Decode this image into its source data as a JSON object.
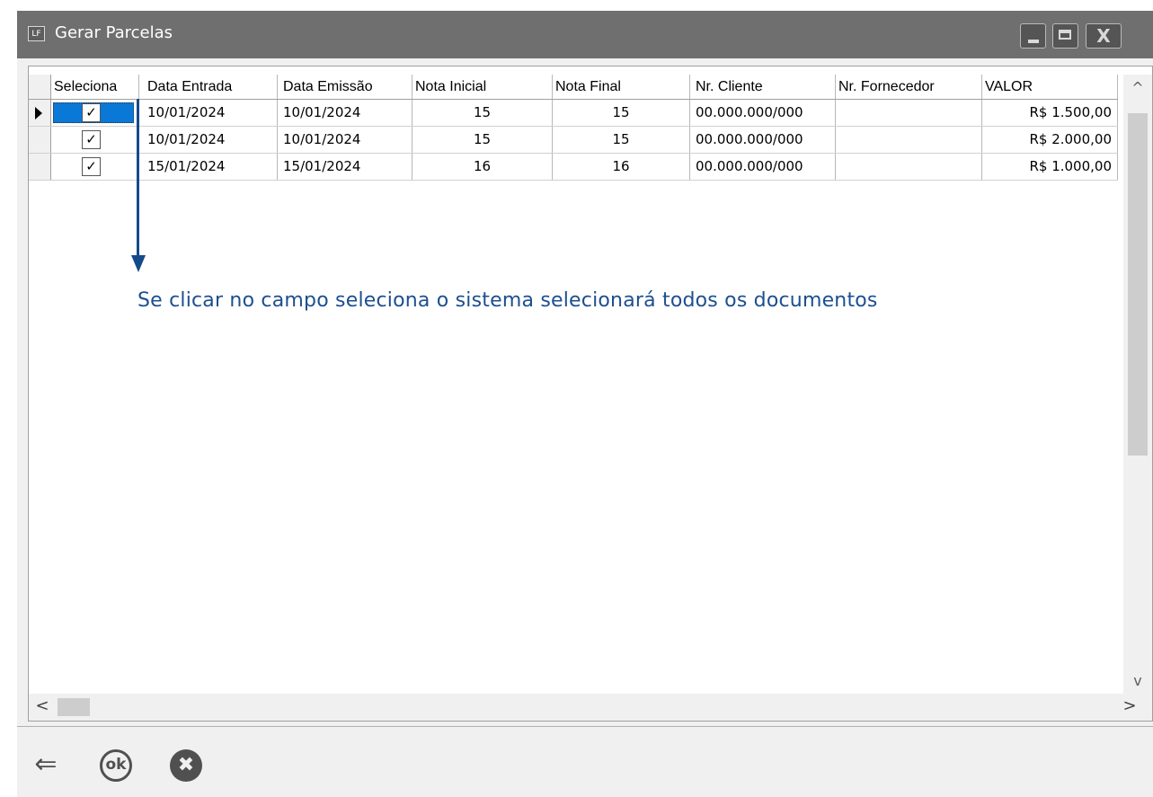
{
  "window": {
    "app_icon": "LF",
    "title": "Gerar Parcelas",
    "close_glyph": "X"
  },
  "grid": {
    "columns": [
      "Seleciona",
      "Data Entrada",
      "Data Emissão",
      "Nota Inicial",
      "Nota Final",
      "Nr. Cliente",
      "Nr. Fornecedor",
      "VALOR"
    ],
    "rows": [
      {
        "checked": "✓",
        "data_entrada": "10/01/2024",
        "data_emissao": "10/01/2024",
        "nota_inicial": "15",
        "nota_final": "15",
        "nr_cliente": "00.000.000/000",
        "nr_fornecedor": "",
        "valor": "R$ 1.500,00"
      },
      {
        "checked": "✓",
        "data_entrada": "10/01/2024",
        "data_emissao": "10/01/2024",
        "nota_inicial": "15",
        "nota_final": "15",
        "nr_cliente": "00.000.000/000",
        "nr_fornecedor": "",
        "valor": "R$ 2.000,00"
      },
      {
        "checked": "✓",
        "data_entrada": "15/01/2024",
        "data_emissao": "15/01/2024",
        "nota_inicial": "16",
        "nota_final": "16",
        "nr_cliente": "00.000.000/000",
        "nr_fornecedor": "",
        "valor": "R$ 1.000,00"
      }
    ],
    "selected_row": 1
  },
  "annotation": {
    "text": "Se clicar no campo seleciona o sistema selecionará todos os documentos",
    "color": "#1d4f8f"
  },
  "scrollbars": {
    "up": "^",
    "down": "v",
    "left": "<",
    "right": ">"
  },
  "toolbar": {
    "back_glyph": "⇐",
    "ok_label": "ok",
    "cancel_glyph": "✖"
  },
  "colors": {
    "titlebar": "#6f6f6f",
    "selection": "#0a78d7"
  }
}
